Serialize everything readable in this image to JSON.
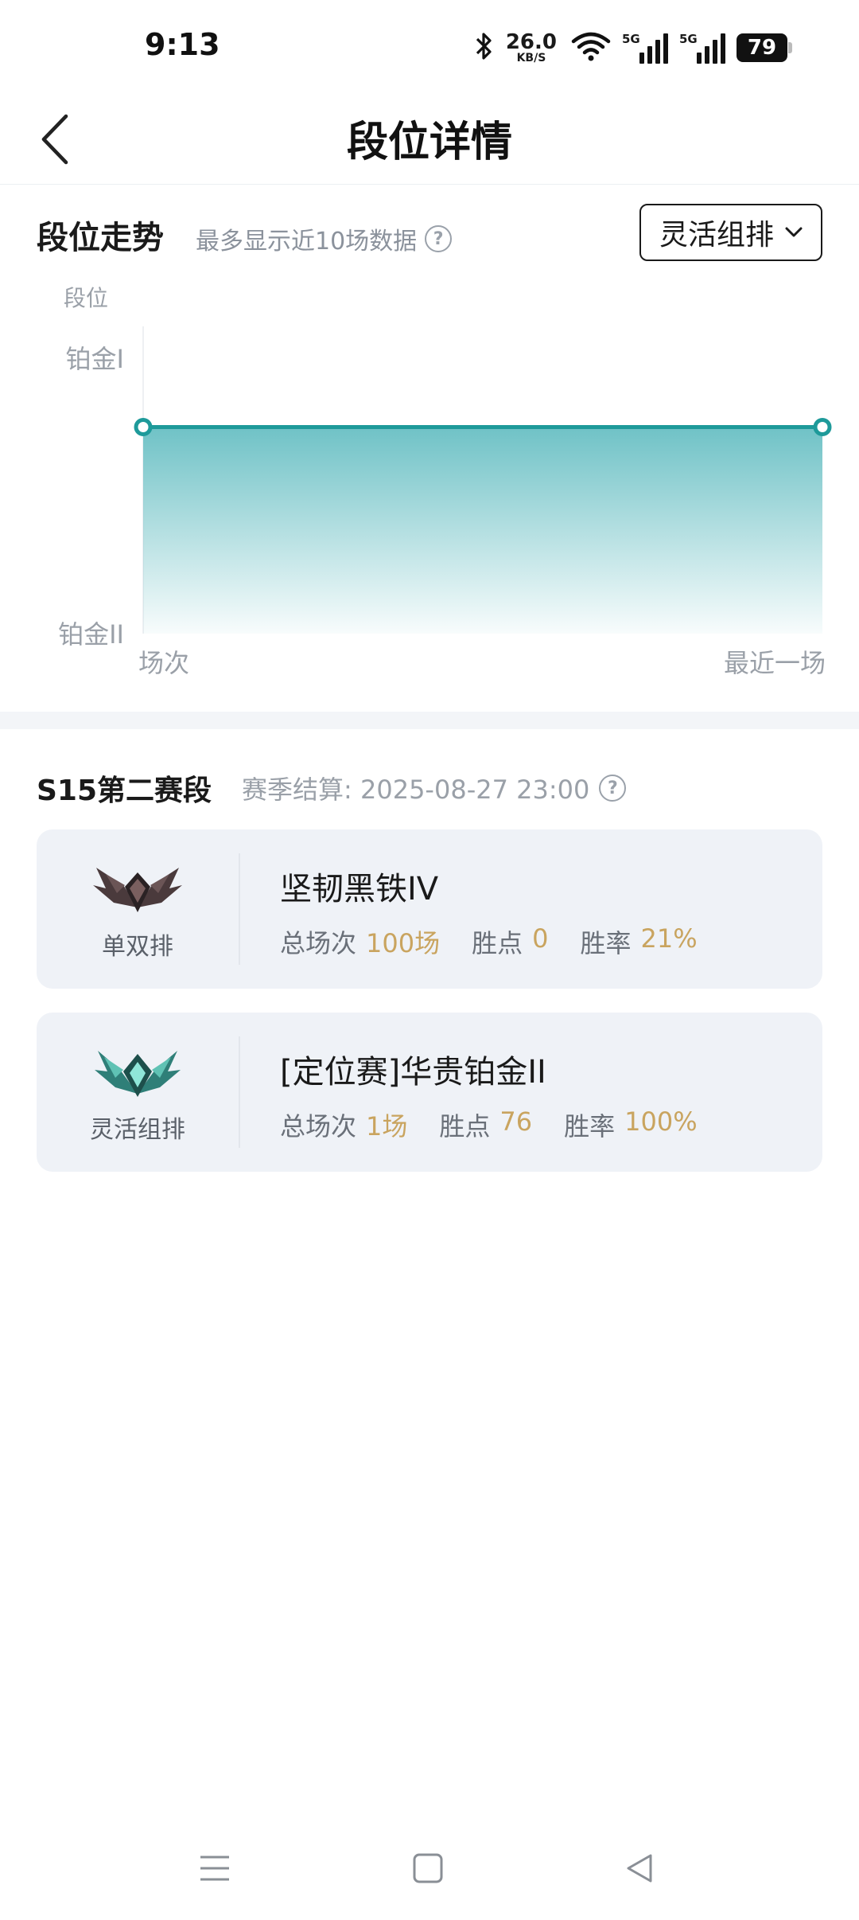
{
  "status_bar": {
    "time": "9:13",
    "net_speed_value": "26.0",
    "net_speed_unit": "KB/S",
    "signal_tag_1": "5G",
    "signal_tag_2": "5G",
    "battery": "79",
    "icons": [
      "bluetooth-icon",
      "wifi-icon",
      "cell-signal-icon",
      "cell-signal-icon",
      "battery-icon"
    ]
  },
  "header": {
    "title": "段位详情",
    "back_icon": "chevron-left-icon"
  },
  "trend": {
    "title": "段位走势",
    "hint": "最多显示近10场数据",
    "mode_selected": "灵活组排"
  },
  "chart_data": {
    "type": "area",
    "y_axis_title": "段位",
    "y_ticks": [
      "铂金II",
      "铂金I"
    ],
    "x_start_label": "场次",
    "x_end_label": "最近一场",
    "points": [
      {
        "x": 1,
        "y": 0.75
      },
      {
        "x": 2,
        "y": 0.75
      }
    ],
    "ylim": [
      0,
      1
    ],
    "line_color": "#1e9a9a",
    "fill_color_top": "#6fc2c6"
  },
  "season": {
    "title": "S15第二赛段",
    "settle_label": "赛季结算: 2025-08-27 23:00"
  },
  "ranks": [
    {
      "queue": "单双排",
      "emblem": "iron-emblem-icon",
      "rank": "坚韧黑铁IV",
      "total_label": "总场次",
      "total": "100场",
      "lp_label": "胜点",
      "lp": "0",
      "winrate_label": "胜率",
      "winrate": "21%"
    },
    {
      "queue": "灵活组排",
      "emblem": "platinum-emblem-icon",
      "rank": "[定位赛]华贵铂金II",
      "total_label": "总场次",
      "total": "1场",
      "lp_label": "胜点",
      "lp": "76",
      "winrate_label": "胜率",
      "winrate": "100%"
    }
  ],
  "colors": {
    "accent": "#1e9a9a",
    "stat_value": "#c9a45f",
    "card_bg": "#eff2f7"
  }
}
